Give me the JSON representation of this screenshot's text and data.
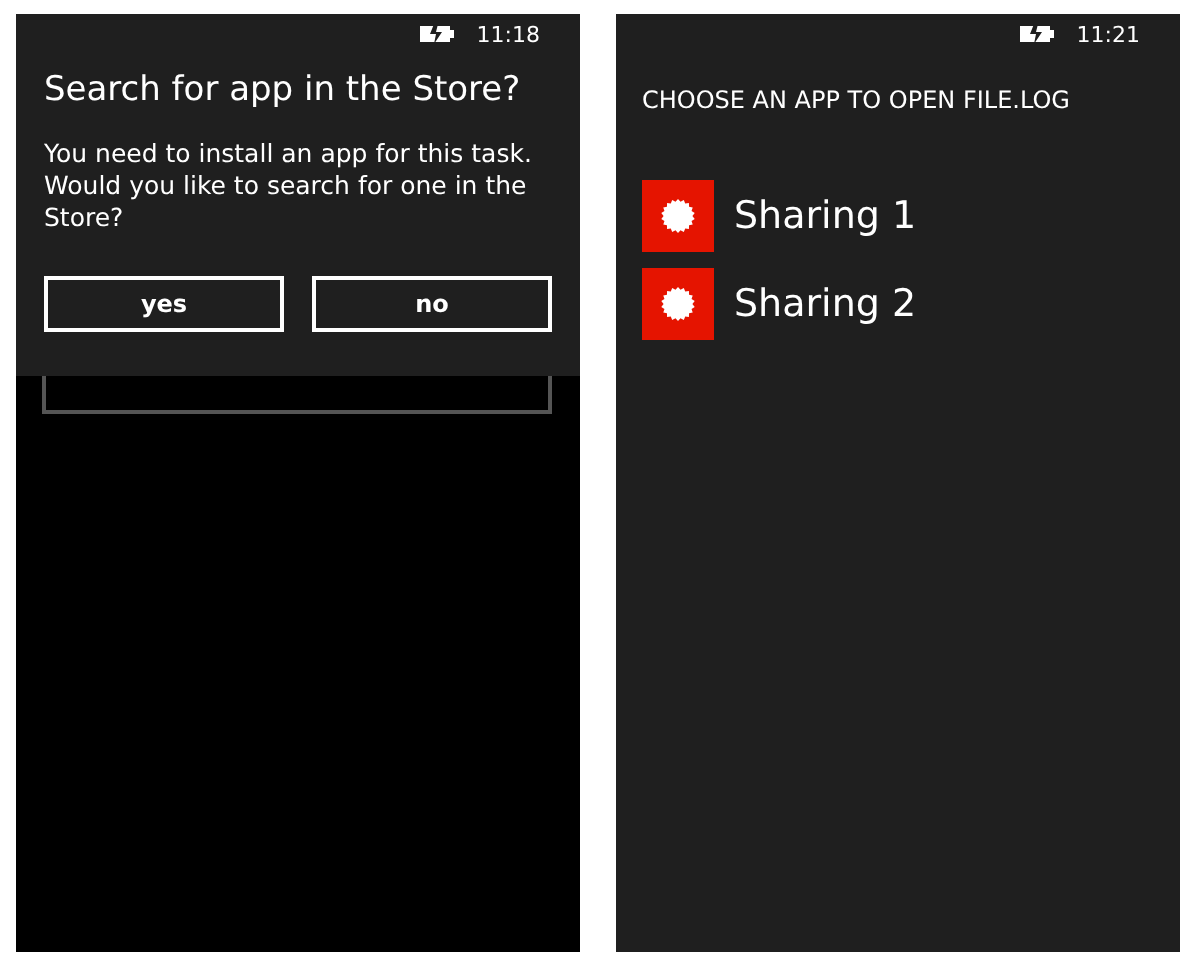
{
  "left_phone": {
    "status_bar": {
      "time": "11:18"
    },
    "dialog": {
      "title": "Search for app in the Store?",
      "message": "You need to install an app for this task. Would you like to search for one in the Store?",
      "buttons": [
        "yes",
        "no"
      ]
    }
  },
  "right_phone": {
    "status_bar": {
      "time": "11:21"
    },
    "heading": "CHOOSE AN APP TO OPEN FILE.LOG",
    "apps": [
      {
        "name": "Sharing 1"
      },
      {
        "name": "Sharing 2"
      }
    ]
  }
}
